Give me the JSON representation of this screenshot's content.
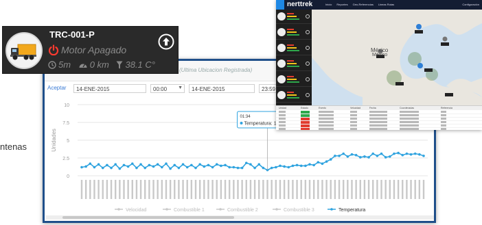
{
  "side_text": "ntenas",
  "vehicle_card": {
    "id": "TRC-001-P",
    "status": "Motor Apagado",
    "time": "5m",
    "distance": "0 km",
    "temperature": "38.1 C°",
    "status_color": "#ff3b30"
  },
  "chart_window": {
    "title": "(Ultima Ubicacion Registrada)",
    "filter": {
      "accept_label": "Aceptar",
      "start_date": "14-ENE-2015",
      "start_time": "00:00",
      "end_date": "14-ENE-2015",
      "end_time": "23:59"
    }
  },
  "chart_data": {
    "type": "line",
    "ylabel": "Unidades",
    "yticks": [
      "10",
      "7.5",
      "5",
      "2.5",
      "0"
    ],
    "ylim": [
      0,
      10
    ],
    "grid": true,
    "legend_position": "bottom",
    "legend": [
      "Velocidad",
      "Combustible 1",
      "Combustible 2",
      "Combustible 3",
      "Temperatura"
    ],
    "tooltip": {
      "header": "01:34",
      "series": "Temperatura",
      "value": "1.1"
    },
    "series": [
      {
        "name": "Temperatura",
        "color": "#2fa3df",
        "values": [
          1.2,
          1.3,
          1.7,
          1.2,
          1.6,
          1.1,
          1.5,
          1.1,
          1.6,
          1.0,
          1.5,
          1.3,
          1.7,
          1.1,
          1.6,
          1.1,
          1.5,
          1.3,
          1.6,
          1.2,
          1.7,
          1.0,
          1.5,
          1.1,
          1.6,
          1.2,
          1.5,
          1.1,
          1.6,
          1.3,
          1.5,
          1.2,
          1.6,
          1.4,
          1.5,
          1.2,
          1.2,
          1.1,
          1.1,
          1.8,
          1.6,
          1.1,
          1.6,
          1.1,
          0.8,
          1.1,
          1.2,
          1.4,
          1.3,
          1.2,
          1.4,
          1.5,
          1.4,
          1.4,
          1.6,
          1.5,
          1.9,
          1.7,
          2.0,
          2.3,
          2.8,
          2.8,
          3.1,
          2.7,
          3.0,
          2.9,
          2.6,
          2.7,
          2.6,
          3.1,
          2.8,
          3.1,
          2.6,
          2.7,
          3.1,
          3.2,
          2.9,
          3.1,
          3.0,
          3.1,
          3.0,
          2.8
        ]
      }
    ]
  },
  "map_window": {
    "logo": "nerttrek",
    "nav": [
      "Inicio",
      "Reportes",
      "Geo-Referencias",
      "Lineas Rutas"
    ],
    "right_nav": [
      "Configuración"
    ],
    "map_labels": [
      "México",
      "México"
    ],
    "table_headers": [
      "Unidad",
      "Estado",
      "Evento",
      "Velocidad",
      "Fecha",
      "Coordenadas",
      "Referencia"
    ],
    "table_rows": 6
  }
}
